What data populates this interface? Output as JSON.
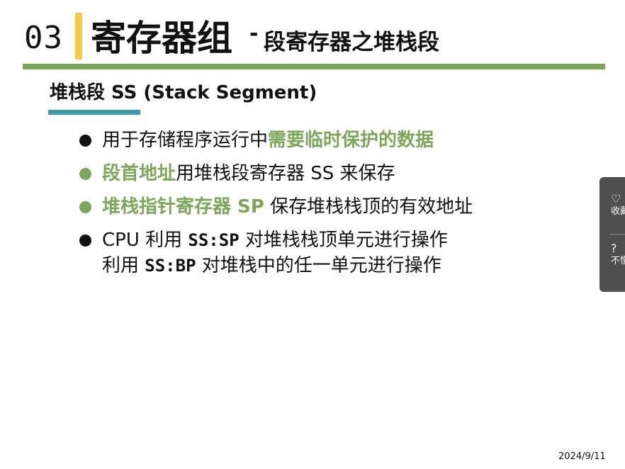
{
  "header": {
    "section_number": "03",
    "title_main": "寄存器组",
    "title_separator": "-",
    "title_sub": "段寄存器之堆栈段"
  },
  "subtitle": "堆栈段 SS (Stack Segment)",
  "bullets": [
    {
      "pre": "用于存储程序运行中",
      "highlight": "需要临时保护的数据",
      "post": ""
    },
    {
      "highlight": "段首地址",
      "post": "用堆栈段寄存器 SS 来保存"
    },
    {
      "highlight": "堆栈指针寄存器 SP",
      "post": " 保存堆栈栈顶的有效地址"
    },
    {
      "line1_pre": "CPU 利用 ",
      "line1_code": "SS:SP",
      "line1_post": " 对堆栈栈顶单元进行操作",
      "line2_pre": "利用 ",
      "line2_code": "SS:BP",
      "line2_post": " 对堆栈中的任一单元进行操作"
    }
  ],
  "side_panel": {
    "favorite_icon": "heart-icon",
    "favorite_label": "收藏",
    "help_icon": "question-icon",
    "help_label": "不懂"
  },
  "footer": {
    "date": "2024/9/11"
  },
  "colors": {
    "accent_yellow": "#f5c94a",
    "accent_green": "#7ca65a",
    "accent_teal": "#3f9aa7",
    "panel_bg": "#4f4f4f"
  }
}
